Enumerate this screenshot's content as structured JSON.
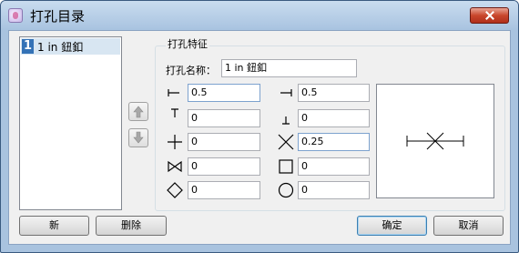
{
  "window": {
    "title": "打孔目录"
  },
  "list": {
    "items": [
      {
        "number": "1",
        "label": "1 in 鈕釦"
      }
    ]
  },
  "group": {
    "title": "打孔特征",
    "name_label": "打孔名称：",
    "name_value": "1 in 鈕釦",
    "fields": {
      "left_offset": "0.5",
      "right_offset": "0.5",
      "top_offset": "0",
      "bottom_offset": "0",
      "cross_value": "0",
      "x_value": "0.25",
      "bowtie_value": "0",
      "square_value": "0",
      "diamond_value": "0",
      "circle_value": "0"
    },
    "icons": [
      "left-tick-icon",
      "right-tick-icon",
      "top-tick-icon",
      "bottom-tick-icon",
      "plus-icon",
      "x-icon",
      "bowtie-icon",
      "square-icon",
      "diamond-icon",
      "circle-icon"
    ]
  },
  "buttons": {
    "new": "新",
    "delete": "删除",
    "ok": "确定",
    "cancel": "取消"
  },
  "colors": {
    "titlebar": "#a8c3e0",
    "close": "#c9462c",
    "selection": "#3472b6"
  }
}
